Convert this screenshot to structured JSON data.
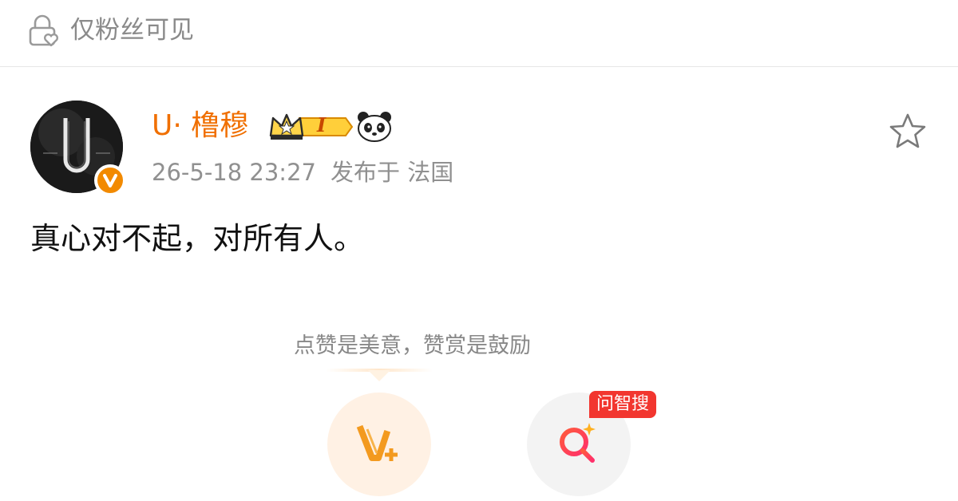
{
  "visibility": {
    "label": "仅粉丝可见",
    "icon": "lock-heart-icon"
  },
  "post": {
    "author": {
      "name": "U· 橹穆",
      "avatar_letter": "U",
      "verified_icon": "verified-v-icon",
      "vip_level": "I",
      "vip_icon": "crown-icon",
      "extra_icon": "panda-icon"
    },
    "meta": {
      "timestamp": "26-5-18 23:27",
      "location": "发布于 法国"
    },
    "favorite_icon": "star-outline-icon",
    "content": "真心对不起，对所有人。"
  },
  "actions": {
    "hint": "点赞是美意，赞赏是鼓励",
    "reward_icon": "v-plus-reward-icon",
    "search_icon": "ai-search-icon",
    "search_badge": "问智搜"
  },
  "colors": {
    "accent_orange": "#f06f00",
    "badge_red": "#f2362f",
    "reward_bg": "#fff1e4"
  }
}
